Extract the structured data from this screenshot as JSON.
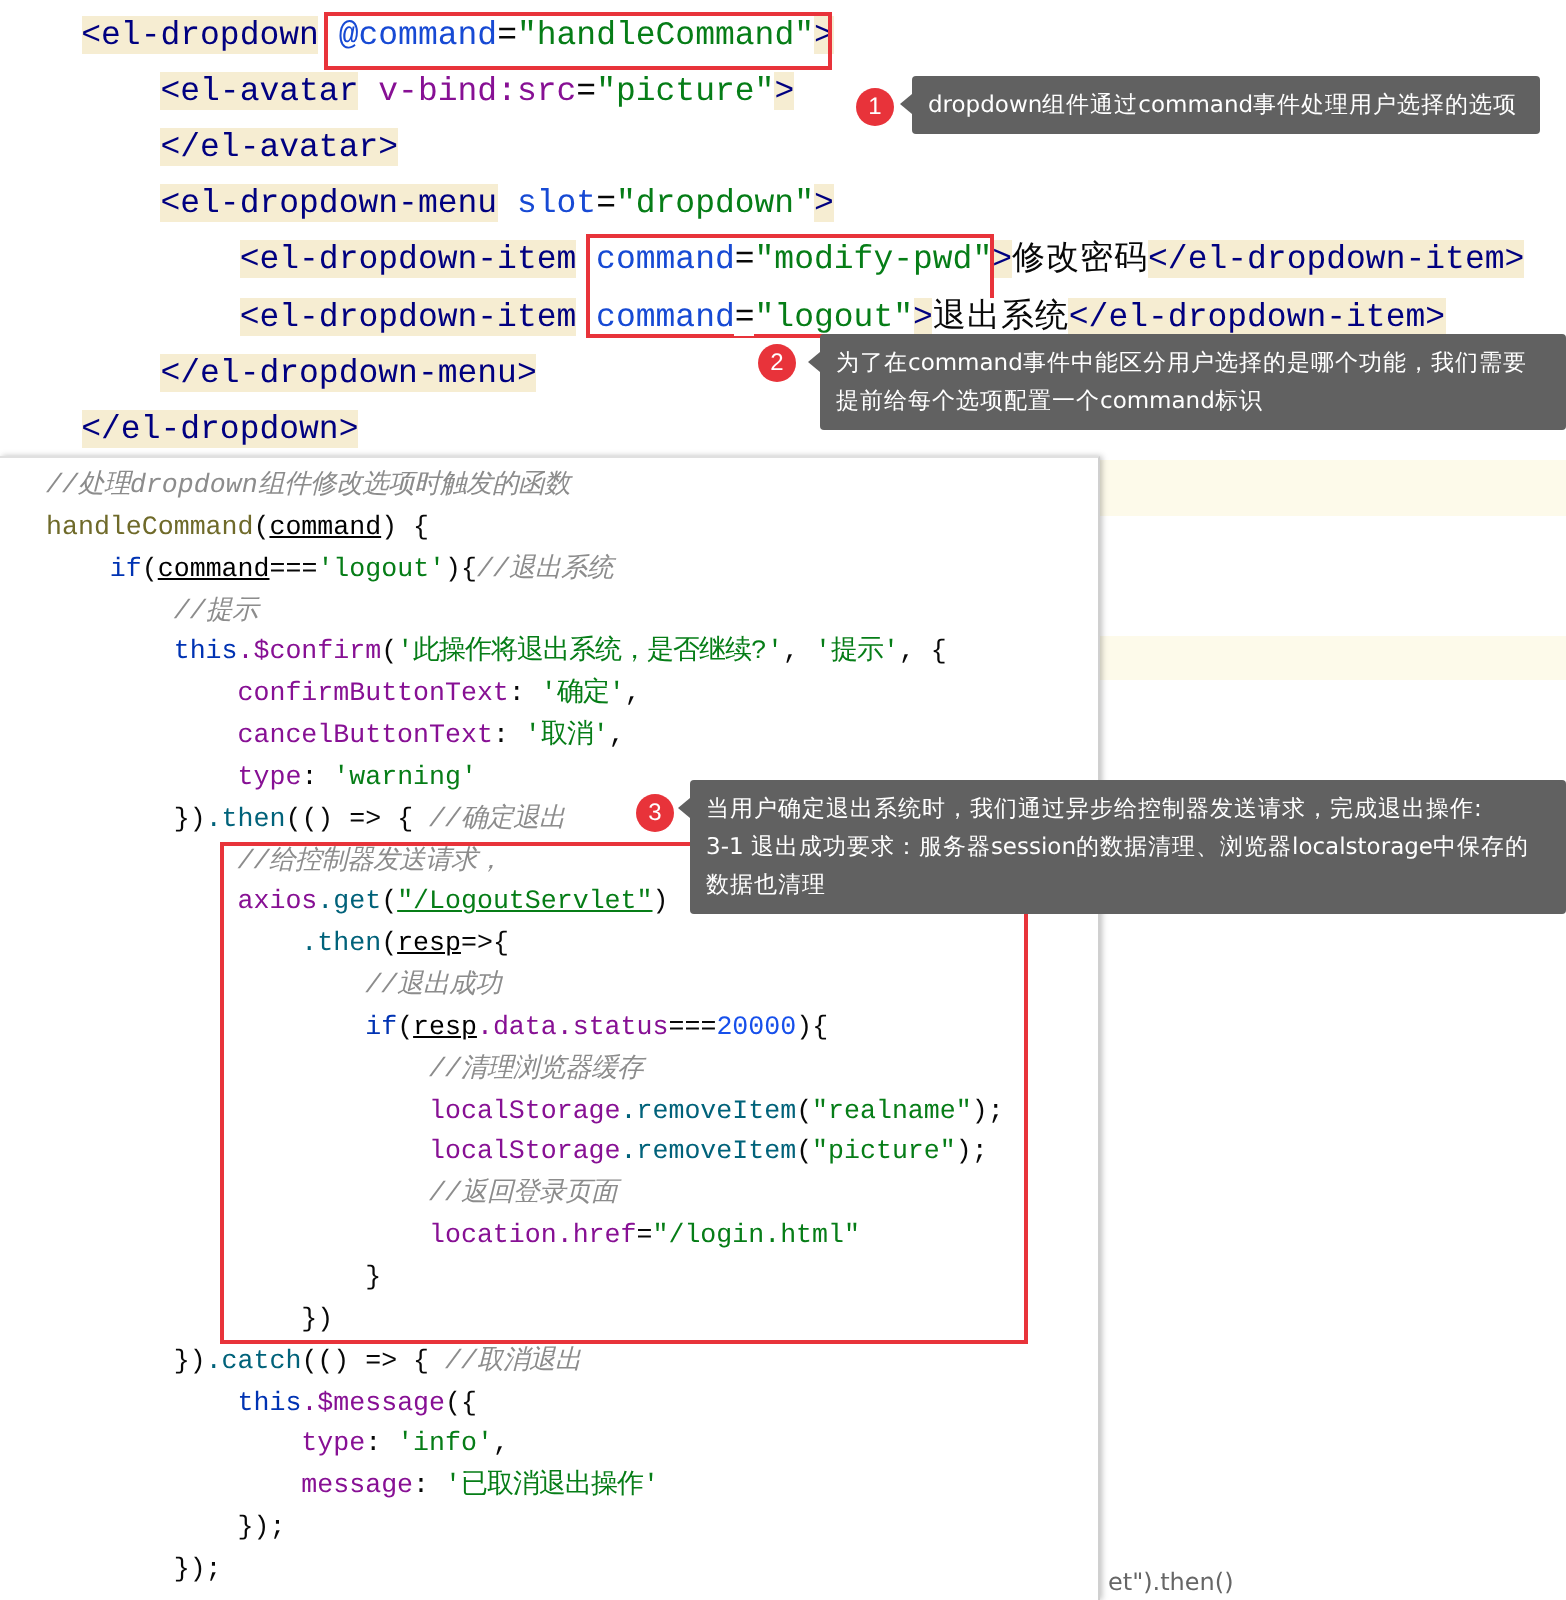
{
  "template_code": {
    "lines": [
      [
        {
          "kind": "tag",
          "text": "    <el-dropdown"
        },
        {
          "kind": "attr",
          "text": " @command"
        },
        {
          "kind": "plain",
          "text": "="
        },
        {
          "kind": "string",
          "text": "\"handleCommand\""
        },
        {
          "kind": "tag",
          "text": ">"
        }
      ],
      [
        {
          "kind": "tag",
          "text": "        <el-avatar"
        },
        {
          "kind": "binding",
          "text": " v-bind:src"
        },
        {
          "kind": "plain",
          "text": "="
        },
        {
          "kind": "string",
          "text": "\"picture\""
        },
        {
          "kind": "tag",
          "text": ">"
        }
      ],
      [
        {
          "kind": "tag",
          "text": "        </el-avatar>"
        }
      ],
      [
        {
          "kind": "tag",
          "text": "        <el-dropdown-menu"
        },
        {
          "kind": "attr",
          "text": " slot"
        },
        {
          "kind": "plain",
          "text": "="
        },
        {
          "kind": "string",
          "text": "\"dropdown\""
        },
        {
          "kind": "tag",
          "text": ">"
        }
      ],
      [
        {
          "kind": "tag",
          "text": "            <el-dropdown-item"
        },
        {
          "kind": "attr",
          "text": " command"
        },
        {
          "kind": "plain",
          "text": "="
        },
        {
          "kind": "string",
          "text": "\"modify-pwd\""
        },
        {
          "kind": "tag",
          "text": ">"
        },
        {
          "kind": "plain",
          "text": "修改密码"
        },
        {
          "kind": "tag",
          "text": "</el-dropdown-item>"
        }
      ],
      [
        {
          "kind": "tag",
          "text": "            <el-dropdown-item"
        },
        {
          "kind": "attr",
          "text": " command"
        },
        {
          "kind": "plain",
          "text": "="
        },
        {
          "kind": "string",
          "text": "\"logout\""
        },
        {
          "kind": "tag",
          "text": ">"
        },
        {
          "kind": "plain",
          "text": "退出系统"
        },
        {
          "kind": "tag",
          "text": "</el-dropdown-item>"
        }
      ],
      [
        {
          "kind": "tag",
          "text": "        </el-dropdown-menu>"
        }
      ],
      [
        {
          "kind": "tag",
          "text": "    </el-dropdown>"
        }
      ]
    ]
  },
  "script_code": {
    "lines": [
      [
        {
          "kind": "comment",
          "text": "//处理dropdown组件修改选项时触发的函数"
        }
      ],
      [
        {
          "kind": "fn",
          "text": "handleCommand"
        },
        {
          "kind": "plain",
          "text": "("
        },
        {
          "kind": "param",
          "text": "command"
        },
        {
          "kind": "plain",
          "text": ") {"
        }
      ],
      [
        {
          "kind": "keyword",
          "text": "    if"
        },
        {
          "kind": "plain",
          "text": "("
        },
        {
          "kind": "param",
          "text": "command"
        },
        {
          "kind": "plain",
          "text": "==="
        },
        {
          "kind": "string",
          "text": "'logout'"
        },
        {
          "kind": "plain",
          "text": "){"
        },
        {
          "kind": "comment",
          "text": "//退出系统"
        }
      ],
      [
        {
          "kind": "comment",
          "text": "        //提示"
        }
      ],
      [
        {
          "kind": "keyword",
          "text": "        this"
        },
        {
          "kind": "prop",
          "text": ".$confirm"
        },
        {
          "kind": "plain",
          "text": "("
        },
        {
          "kind": "string",
          "text": "'此操作将退出系统，是否继续?'"
        },
        {
          "kind": "plain",
          "text": ", "
        },
        {
          "kind": "string",
          "text": "'提示'"
        },
        {
          "kind": "plain",
          "text": ", {"
        }
      ],
      [
        {
          "kind": "prop",
          "text": "            confirmButtonText"
        },
        {
          "kind": "plain",
          "text": ": "
        },
        {
          "kind": "string",
          "text": "'确定'"
        },
        {
          "kind": "plain",
          "text": ","
        }
      ],
      [
        {
          "kind": "prop",
          "text": "            cancelButtonText"
        },
        {
          "kind": "plain",
          "text": ": "
        },
        {
          "kind": "string",
          "text": "'取消'"
        },
        {
          "kind": "plain",
          "text": ","
        }
      ],
      [
        {
          "kind": "prop",
          "text": "            type"
        },
        {
          "kind": "plain",
          "text": ": "
        },
        {
          "kind": "string",
          "text": "'warning'"
        }
      ],
      [
        {
          "kind": "plain",
          "text": "        })"
        },
        {
          "kind": "method",
          "text": ".then"
        },
        {
          "kind": "plain",
          "text": "(() => { "
        },
        {
          "kind": "comment",
          "text": "//确定退出"
        }
      ],
      [
        {
          "kind": "comment",
          "text": "            //给控制器发送请求，"
        }
      ],
      [
        {
          "kind": "prop",
          "text": "            axios"
        },
        {
          "kind": "method",
          "text": ".get"
        },
        {
          "kind": "plain",
          "text": "("
        },
        {
          "kind": "link",
          "text": "\"/LogoutServlet\""
        },
        {
          "kind": "plain",
          "text": ")"
        }
      ],
      [
        {
          "kind": "method",
          "text": "                .then"
        },
        {
          "kind": "plain",
          "text": "("
        },
        {
          "kind": "param",
          "text": "resp"
        },
        {
          "kind": "plain",
          "text": "=>{"
        }
      ],
      [
        {
          "kind": "comment",
          "text": "                    //退出成功"
        }
      ],
      [
        {
          "kind": "keyword",
          "text": "                    if"
        },
        {
          "kind": "plain",
          "text": "("
        },
        {
          "kind": "param",
          "text": "resp"
        },
        {
          "kind": "prop",
          "text": ".data.status"
        },
        {
          "kind": "plain",
          "text": "==="
        },
        {
          "kind": "number",
          "text": "20000"
        },
        {
          "kind": "plain",
          "text": "){"
        }
      ],
      [
        {
          "kind": "comment",
          "text": "                        //清理浏览器缓存"
        }
      ],
      [
        {
          "kind": "prop",
          "text": "                        localStorage"
        },
        {
          "kind": "method",
          "text": ".removeItem"
        },
        {
          "kind": "plain",
          "text": "("
        },
        {
          "kind": "string",
          "text": "\"realname\""
        },
        {
          "kind": "plain",
          "text": ");"
        }
      ],
      [
        {
          "kind": "prop",
          "text": "                        localStorage"
        },
        {
          "kind": "method",
          "text": ".removeItem"
        },
        {
          "kind": "plain",
          "text": "("
        },
        {
          "kind": "string",
          "text": "\"picture\""
        },
        {
          "kind": "plain",
          "text": ");"
        }
      ],
      [
        {
          "kind": "comment",
          "text": "                        //返回登录页面"
        }
      ],
      [
        {
          "kind": "prop",
          "text": "                        location.href"
        },
        {
          "kind": "plain",
          "text": "="
        },
        {
          "kind": "string",
          "text": "\"/login.html\""
        }
      ],
      [
        {
          "kind": "plain",
          "text": "                    }"
        }
      ],
      [
        {
          "kind": "plain",
          "text": "                })"
        }
      ],
      [
        {
          "kind": "plain",
          "text": "        })"
        },
        {
          "kind": "method",
          "text": ".catch"
        },
        {
          "kind": "plain",
          "text": "(() => { "
        },
        {
          "kind": "comment",
          "text": "//取消退出"
        }
      ],
      [
        {
          "kind": "keyword",
          "text": "            this"
        },
        {
          "kind": "prop",
          "text": ".$message"
        },
        {
          "kind": "plain",
          "text": "({"
        }
      ],
      [
        {
          "kind": "prop",
          "text": "                type"
        },
        {
          "kind": "plain",
          "text": ": "
        },
        {
          "kind": "string",
          "text": "'info'"
        },
        {
          "kind": "plain",
          "text": ","
        }
      ],
      [
        {
          "kind": "prop",
          "text": "                message"
        },
        {
          "kind": "plain",
          "text": ": "
        },
        {
          "kind": "string",
          "text": "'已取消退出操作'"
        }
      ],
      [
        {
          "kind": "plain",
          "text": "            });"
        }
      ],
      [
        {
          "kind": "plain",
          "text": "        });"
        }
      ]
    ]
  },
  "background_fragment": "et\").then()",
  "annotations": [
    {
      "number": "1",
      "paragraphs": [
        "dropdown组件通过command事件处理用户选择的选项"
      ]
    },
    {
      "number": "2",
      "paragraphs": [
        "为了在command事件中能区分用户选择的是哪个功能，我们需要提前给每个选项配置一个command标识"
      ]
    },
    {
      "number": "3",
      "paragraphs": [
        "当用户确定退出系统时，我们通过异步给控制器发送请求，完成退出操作:",
        "3-1 退出成功要求：服务器session的数据清理、浏览器localstorage中保存的数据也清理"
      ]
    }
  ]
}
